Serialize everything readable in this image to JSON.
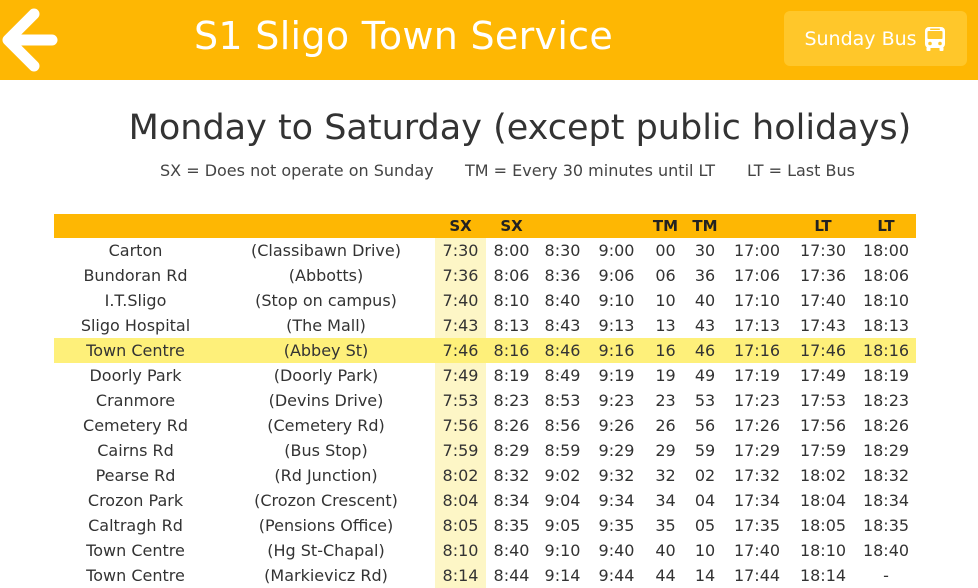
{
  "header": {
    "title": "S1 Sligo Town Service",
    "sunday_button_label": "Sunday Bus",
    "back_icon": "arrow-left-icon",
    "bus_icon": "bus-icon",
    "bar_color": "#feb703"
  },
  "schedule": {
    "heading": "Monday to Saturday (except public holidays)",
    "legend": [
      "SX = Does not operate on Sunday",
      "TM = Every 30 minutes until LT",
      "LT = Last Bus"
    ],
    "columns": [
      "",
      "",
      "SX",
      "SX",
      "",
      "",
      "TM",
      "TM",
      "",
      "LT",
      "LT"
    ],
    "highlight_color": "#fef07a",
    "rows": [
      {
        "stop": "Carton",
        "location": "(Classibawn Drive)",
        "times": [
          "7:30",
          "8:00",
          "8:30",
          "9:00",
          "00",
          "30",
          "17:00",
          "17:30",
          "18:00"
        ]
      },
      {
        "stop": "Bundoran Rd",
        "location": "(Abbotts)",
        "times": [
          "7:36",
          "8:06",
          "8:36",
          "9:06",
          "06",
          "36",
          "17:06",
          "17:36",
          "18:06"
        ]
      },
      {
        "stop": "I.T.Sligo",
        "location": "(Stop on campus)",
        "times": [
          "7:40",
          "8:10",
          "8:40",
          "9:10",
          "10",
          "40",
          "17:10",
          "17:40",
          "18:10"
        ]
      },
      {
        "stop": "Sligo Hospital",
        "location": "(The Mall)",
        "times": [
          "7:43",
          "8:13",
          "8:43",
          "9:13",
          "13",
          "43",
          "17:13",
          "17:43",
          "18:13"
        ]
      },
      {
        "stop": "Town Centre",
        "location": "(Abbey St)",
        "times": [
          "7:46",
          "8:16",
          "8:46",
          "9:16",
          "16",
          "46",
          "17:16",
          "17:46",
          "18:16"
        ],
        "highlight": true
      },
      {
        "stop": "Doorly Park",
        "location": "(Doorly Park)",
        "times": [
          "7:49",
          "8:19",
          "8:49",
          "9:19",
          "19",
          "49",
          "17:19",
          "17:49",
          "18:19"
        ]
      },
      {
        "stop": "Cranmore",
        "location": "(Devins Drive)",
        "times": [
          "7:53",
          "8:23",
          "8:53",
          "9:23",
          "23",
          "53",
          "17:23",
          "17:53",
          "18:23"
        ]
      },
      {
        "stop": "Cemetery Rd",
        "location": "(Cemetery Rd)",
        "times": [
          "7:56",
          "8:26",
          "8:56",
          "9:26",
          "26",
          "56",
          "17:26",
          "17:56",
          "18:26"
        ]
      },
      {
        "stop": "Cairns Rd",
        "location": "(Bus Stop)",
        "times": [
          "7:59",
          "8:29",
          "8:59",
          "9:29",
          "29",
          "59",
          "17:29",
          "17:59",
          "18:29"
        ]
      },
      {
        "stop": "Pearse Rd",
        "location": "(Rd Junction)",
        "times": [
          "8:02",
          "8:32",
          "9:02",
          "9:32",
          "32",
          "02",
          "17:32",
          "18:02",
          "18:32"
        ]
      },
      {
        "stop": "Crozon Park",
        "location": "(Crozon Crescent)",
        "times": [
          "8:04",
          "8:34",
          "9:04",
          "9:34",
          "34",
          "04",
          "17:34",
          "18:04",
          "18:34"
        ]
      },
      {
        "stop": "Caltragh Rd",
        "location": "(Pensions Office)",
        "times": [
          "8:05",
          "8:35",
          "9:05",
          "9:35",
          "35",
          "05",
          "17:35",
          "18:05",
          "18:35"
        ]
      },
      {
        "stop": "Town Centre",
        "location": "(Hg St-Chapal)",
        "times": [
          "8:10",
          "8:40",
          "9:10",
          "9:40",
          "40",
          "10",
          "17:40",
          "18:10",
          "18:40"
        ]
      },
      {
        "stop": "Town Centre",
        "location": "(Markievicz Rd)",
        "times": [
          "8:14",
          "8:44",
          "9:14",
          "9:44",
          "44",
          "14",
          "17:44",
          "18:14",
          "-"
        ]
      }
    ]
  }
}
